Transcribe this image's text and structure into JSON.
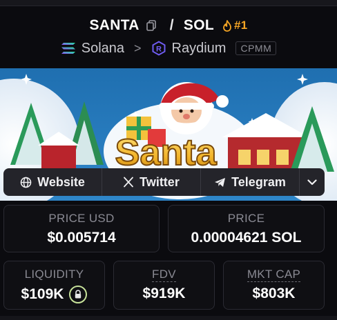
{
  "pair": {
    "base": "SANTA",
    "separator": "/",
    "quote": "SOL",
    "rank": "#1"
  },
  "chain": {
    "name": "Solana",
    "chevron": ">",
    "dex": "Raydium",
    "pool_type": "CPMM"
  },
  "banner": {
    "text": "Santa"
  },
  "links": [
    {
      "label": "Website",
      "icon": "globe-icon"
    },
    {
      "label": "Twitter",
      "icon": "x-logo-icon"
    },
    {
      "label": "Telegram",
      "icon": "telegram-icon"
    }
  ],
  "stats": {
    "price_usd": {
      "label": "PRICE USD",
      "value": "$0.005714"
    },
    "price": {
      "label": "PRICE",
      "value": "0.00004621 SOL"
    },
    "liquidity": {
      "label": "LIQUIDITY",
      "value": "$109K"
    },
    "fdv": {
      "label": "FDV",
      "value": "$919K"
    },
    "mkt_cap": {
      "label": "MKT CAP",
      "value": "$803K"
    }
  },
  "colors": {
    "accent_orange": "#f5a524",
    "lock_green": "#c7e29a",
    "background": "#0b0b0f",
    "card_border": "#2b2b33"
  }
}
